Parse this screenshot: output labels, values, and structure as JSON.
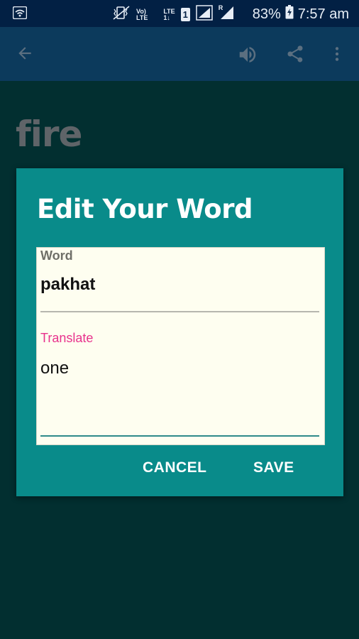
{
  "status_bar": {
    "volte_top": "Vo)",
    "volte_bottom": "LTE",
    "lte_top": "LTE",
    "lte_bottom": "1↓",
    "sim_number": "1",
    "signal_badge": "R",
    "battery_percent": "83%",
    "time": "7:57 am"
  },
  "app_bar": {
    "back_icon": "arrow-left-icon",
    "speaker_icon": "volume-icon",
    "share_icon": "share-icon",
    "menu_icon": "more-vert-icon"
  },
  "word_display": "fire",
  "dialog": {
    "title": "Edit Your Word",
    "word_label": "Word",
    "word_value": "pakhat",
    "translate_label": "Translate",
    "translate_value": "one",
    "cancel_label": "CANCEL",
    "save_label": "SAVE"
  },
  "colors": {
    "background": "#022f30",
    "status_bar": "#022044",
    "app_bar": "#0c3a5c",
    "dialog": "#098b8a",
    "form_card": "#fefef0",
    "translate_label": "#e8328d"
  }
}
